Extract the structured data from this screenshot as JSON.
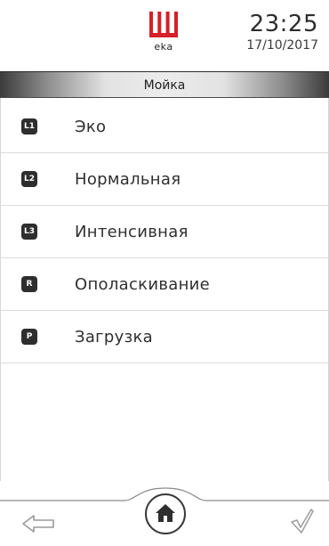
{
  "header": {
    "logo_text": "eka",
    "time": "23:25",
    "date": "17/10/2017"
  },
  "title": "Мойка",
  "menu": {
    "items": [
      {
        "badge": "L1",
        "label": "Эко"
      },
      {
        "badge": "L2",
        "label": "Нормальная"
      },
      {
        "badge": "L3",
        "label": "Интенсивная"
      },
      {
        "badge": "R",
        "label": "Ополаскивание"
      },
      {
        "badge": "P",
        "label": "Загрузка"
      }
    ]
  },
  "footer": {
    "back_icon": "arrow-left-icon",
    "home_icon": "home-icon",
    "confirm_icon": "checkmark-icon"
  },
  "colors": {
    "logo_red": "#d6202a",
    "badge": "#2e2e2e",
    "text": "#2f2f2f"
  }
}
